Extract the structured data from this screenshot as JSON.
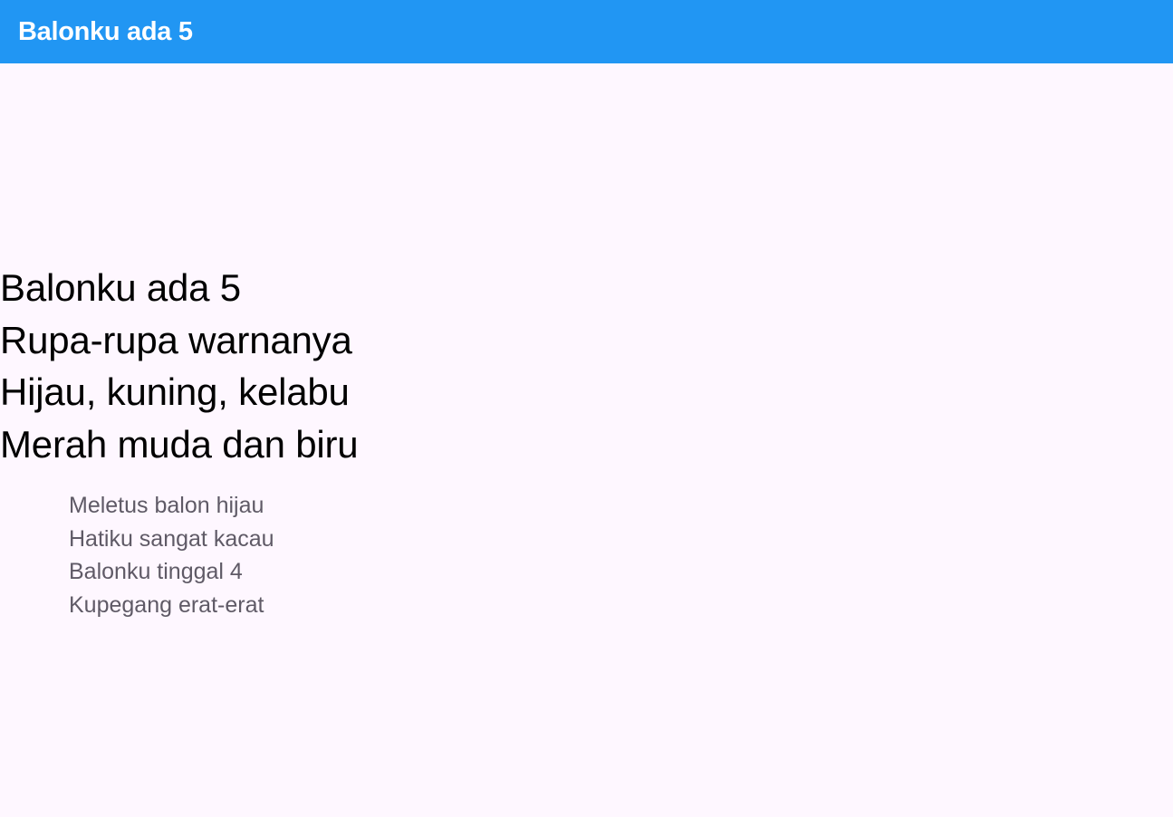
{
  "app_bar": {
    "title": "Balonku ada 5"
  },
  "verse": {
    "lines": [
      "Balonku ada 5",
      "Rupa-rupa warnanya",
      "Hijau, kuning, kelabu",
      "Merah muda dan biru"
    ]
  },
  "chorus": {
    "lines": [
      "Meletus balon hijau",
      "Hatiku sangat kacau",
      "Balonku tinggal 4",
      "Kupegang erat-erat"
    ]
  },
  "colors": {
    "app_bar": "#2196f3",
    "background": "#fef7ff",
    "verse_text": "#000000",
    "chorus_text": "#5f5a66"
  }
}
